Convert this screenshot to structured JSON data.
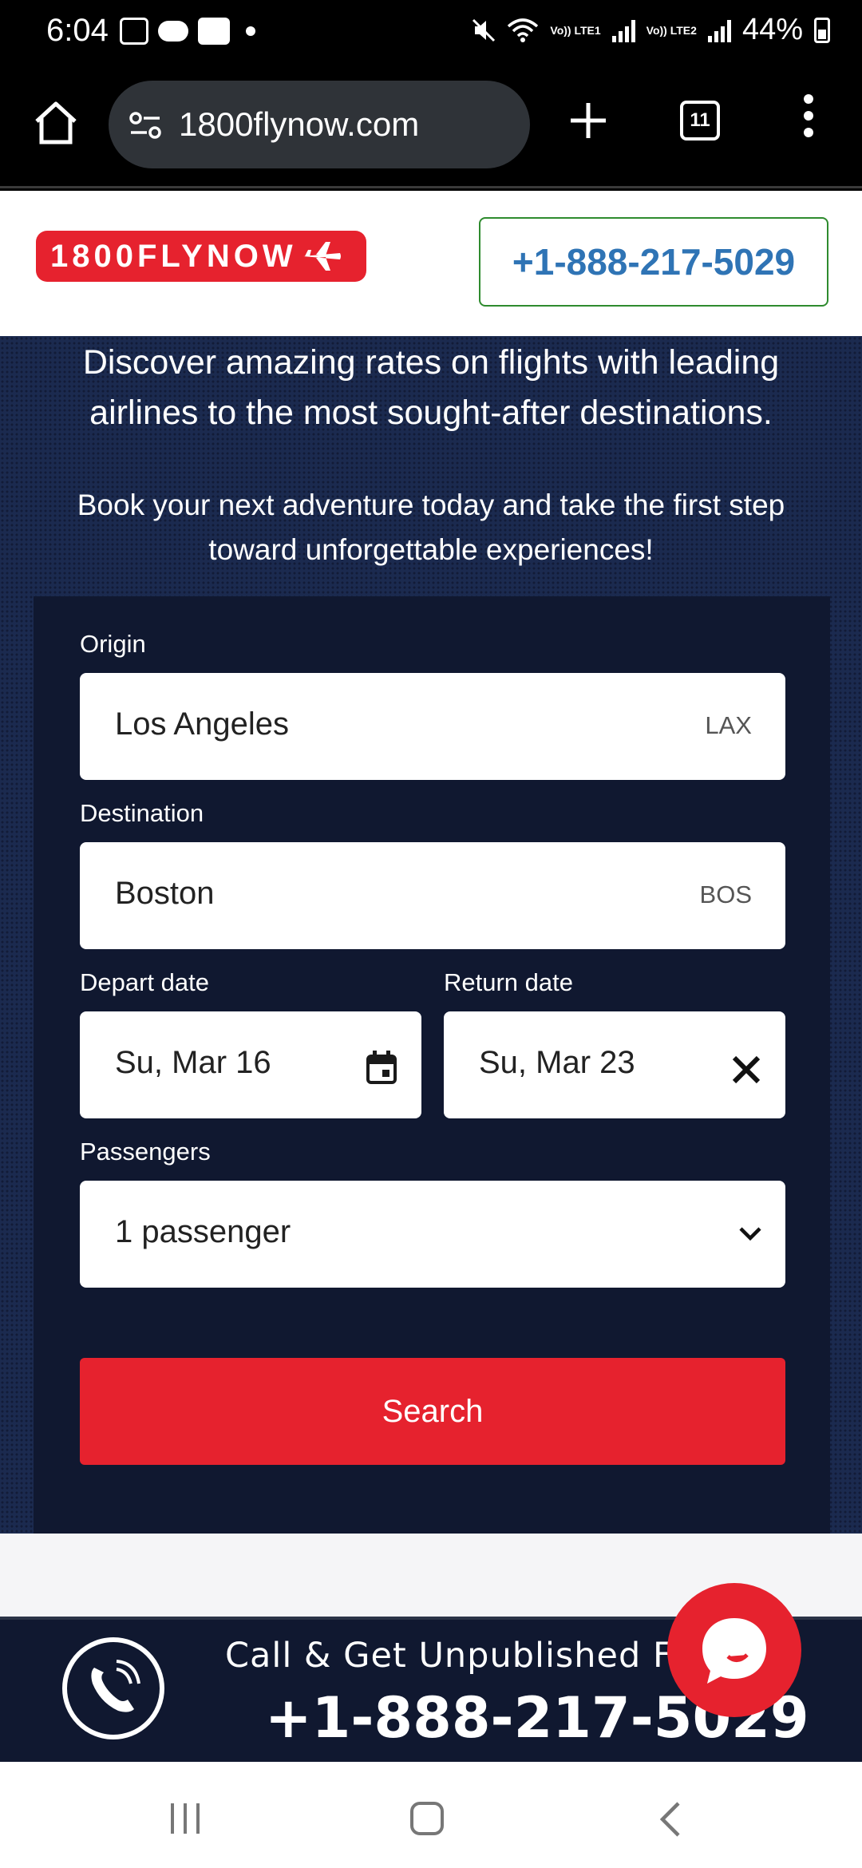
{
  "status_bar": {
    "time": "6:04",
    "battery": "44%",
    "sim1": "Vo)) LTE1",
    "sim2": "Vo)) LTE2"
  },
  "browser": {
    "url": "1800flynow.com",
    "tab_count": "11"
  },
  "header": {
    "logo_text": "1800FLYNOW",
    "phone": "+1-888-217-5029"
  },
  "hero": {
    "text1": "Discover amazing rates on flights with leading airlines to the most sought-after destinations.",
    "text2": "Book your next adventure today and take the first step toward unforgettable experiences!"
  },
  "form": {
    "origin_label": "Origin",
    "origin_value": "Los Angeles",
    "origin_code": "LAX",
    "destination_label": "Destination",
    "destination_value": "Boston",
    "destination_code": "BOS",
    "depart_label": "Depart date",
    "depart_value": "Su, Mar 16",
    "return_label": "Return date",
    "return_value": "Su, Mar 23",
    "passengers_label": "Passengers",
    "passengers_value": "1 passenger",
    "search_label": "Search"
  },
  "call_banner": {
    "text": "Call & Get Unpublished Flight",
    "number": "+1-888-217-5029"
  },
  "colors": {
    "brand_red": "#e6222e",
    "navy": "#1b2a4f",
    "panel": "#101830",
    "phone_blue": "#2f74b5"
  }
}
